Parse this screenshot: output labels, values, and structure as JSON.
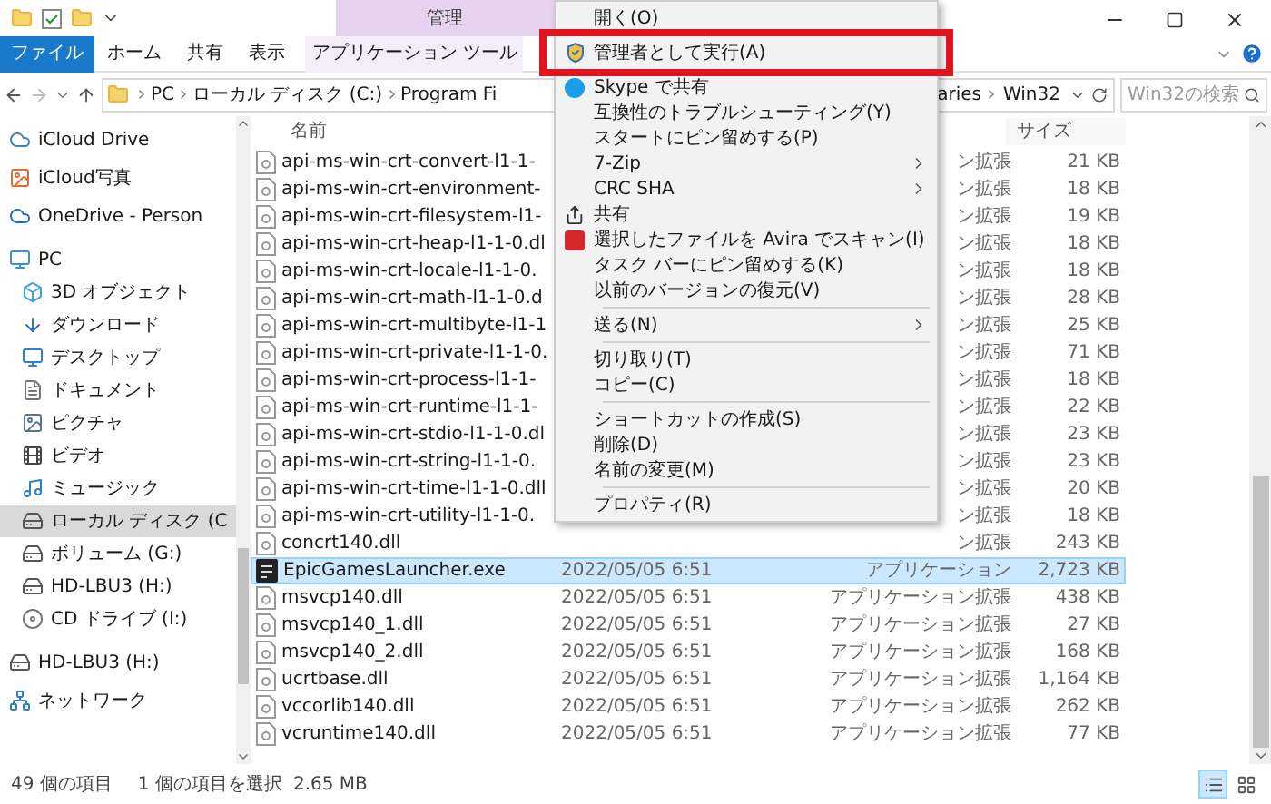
{
  "ribbon": {
    "context_group": "管理",
    "tabs": [
      {
        "label": "ファイル",
        "kind": "file"
      },
      {
        "label": "ホーム",
        "kind": "tab"
      },
      {
        "label": "共有",
        "kind": "tab"
      },
      {
        "label": "表示",
        "kind": "tab"
      },
      {
        "label": "アプリケーション ツール",
        "kind": "contextual"
      }
    ]
  },
  "address": {
    "segments_left": [
      "PC",
      "ローカル ディスク (C:)",
      "Program Fi"
    ],
    "segments_right": [
      "aries",
      "Win32"
    ]
  },
  "search": {
    "placeholder": "Win32の検索"
  },
  "sidebar": {
    "items": [
      {
        "label": "iCloud Drive",
        "kind": "cloud"
      },
      {
        "label": "iCloud写真",
        "kind": "photos"
      },
      {
        "label": "OneDrive - Person",
        "kind": "onedrive"
      },
      {
        "label": "PC",
        "kind": "pc",
        "selected": false,
        "children": [
          {
            "label": "3D オブジェクト",
            "kind": "cube",
            "selected": false
          },
          {
            "label": "ダウンロード",
            "kind": "download",
            "selected": false
          },
          {
            "label": "デスクトップ",
            "kind": "desktop",
            "selected": false
          },
          {
            "label": "ドキュメント",
            "kind": "document",
            "selected": false
          },
          {
            "label": "ピクチャ",
            "kind": "picture",
            "selected": false
          },
          {
            "label": "ビデオ",
            "kind": "video",
            "selected": false
          },
          {
            "label": "ミュージック",
            "kind": "music",
            "selected": false
          },
          {
            "label": "ローカル ディスク (C",
            "kind": "disk",
            "selected": true
          },
          {
            "label": "ボリューム (G:)",
            "kind": "drive",
            "selected": false
          },
          {
            "label": "HD-LBU3 (H:)",
            "kind": "drive",
            "selected": false
          },
          {
            "label": "CD ドライブ (I:)",
            "kind": "cd",
            "selected": false
          }
        ]
      },
      {
        "label": "HD-LBU3 (H:)",
        "kind": "drive"
      },
      {
        "label": "ネットワーク",
        "kind": "network"
      }
    ]
  },
  "table": {
    "columns": [
      "名前",
      "サイズ"
    ],
    "rows": [
      {
        "name": "api-ms-win-crt-convert-l1-1-",
        "type": "ン拡張",
        "size": "21 KB",
        "kind": "dll",
        "selected": false
      },
      {
        "name": "api-ms-win-crt-environment-",
        "type": "ン拡張",
        "size": "18 KB",
        "kind": "dll",
        "selected": false
      },
      {
        "name": "api-ms-win-crt-filesystem-l1-",
        "type": "ン拡張",
        "size": "19 KB",
        "kind": "dll",
        "selected": false
      },
      {
        "name": "api-ms-win-crt-heap-l1-1-0.dl",
        "type": "ン拡張",
        "size": "18 KB",
        "kind": "dll",
        "selected": false
      },
      {
        "name": "api-ms-win-crt-locale-l1-1-0.",
        "type": "ン拡張",
        "size": "18 KB",
        "kind": "dll",
        "selected": false
      },
      {
        "name": "api-ms-win-crt-math-l1-1-0.d",
        "type": "ン拡張",
        "size": "28 KB",
        "kind": "dll",
        "selected": false
      },
      {
        "name": "api-ms-win-crt-multibyte-l1-1",
        "type": "ン拡張",
        "size": "25 KB",
        "kind": "dll",
        "selected": false
      },
      {
        "name": "api-ms-win-crt-private-l1-1-0.",
        "type": "ン拡張",
        "size": "71 KB",
        "kind": "dll",
        "selected": false
      },
      {
        "name": "api-ms-win-crt-process-l1-1-",
        "type": "ン拡張",
        "size": "18 KB",
        "kind": "dll",
        "selected": false
      },
      {
        "name": "api-ms-win-crt-runtime-l1-1-",
        "type": "ン拡張",
        "size": "22 KB",
        "kind": "dll",
        "selected": false
      },
      {
        "name": "api-ms-win-crt-stdio-l1-1-0.dl",
        "type": "ン拡張",
        "size": "23 KB",
        "kind": "dll",
        "selected": false
      },
      {
        "name": "api-ms-win-crt-string-l1-1-0.",
        "type": "ン拡張",
        "size": "23 KB",
        "kind": "dll",
        "selected": false
      },
      {
        "name": "api-ms-win-crt-time-l1-1-0.dll",
        "type": "ン拡張",
        "size": "20 KB",
        "kind": "dll",
        "selected": false
      },
      {
        "name": "api-ms-win-crt-utility-l1-1-0.",
        "type": "ン拡張",
        "size": "18 KB",
        "kind": "dll",
        "selected": false
      },
      {
        "name": "concrt140.dll",
        "type": "ン拡張",
        "size": "243 KB",
        "kind": "dll",
        "selected": false
      },
      {
        "name": "EpicGamesLauncher.exe",
        "date": "2022/05/05 6:51",
        "type": "アプリケーション",
        "size": "2,723 KB",
        "kind": "app",
        "selected": true
      },
      {
        "name": "msvcp140.dll",
        "date": "2022/05/05 6:51",
        "type": "アプリケーション拡張",
        "size": "438 KB",
        "kind": "dll",
        "selected": false
      },
      {
        "name": "msvcp140_1.dll",
        "date": "2022/05/05 6:51",
        "type": "アプリケーション拡張",
        "size": "27 KB",
        "kind": "dll",
        "selected": false
      },
      {
        "name": "msvcp140_2.dll",
        "date": "2022/05/05 6:51",
        "type": "アプリケーション拡張",
        "size": "168 KB",
        "kind": "dll",
        "selected": false
      },
      {
        "name": "ucrtbase.dll",
        "date": "2022/05/05 6:51",
        "type": "アプリケーション拡張",
        "size": "1,164 KB",
        "kind": "dll",
        "selected": false
      },
      {
        "name": "vccorlib140.dll",
        "date": "2022/05/05 6:51",
        "type": "アプリケーション拡張",
        "size": "262 KB",
        "kind": "dll",
        "selected": false
      },
      {
        "name": "vcruntime140.dll",
        "date": "2022/05/05 6:51",
        "type": "アプリケーション拡張",
        "size": "77 KB",
        "kind": "dll",
        "selected": false
      }
    ]
  },
  "context_menu": {
    "items": [
      {
        "kind": "plain",
        "label": "開く(O)",
        "highlighted": false
      },
      {
        "kind": "shield",
        "label": "管理者として実行(A)",
        "highlighted": true
      },
      {
        "kind": "skype",
        "label": "Skype で共有",
        "highlighted": false
      },
      {
        "kind": "plain",
        "label": "互換性のトラブルシューティング(Y)",
        "highlighted": false
      },
      {
        "kind": "plain",
        "label": "スタートにピン留めする(P)",
        "highlighted": false
      },
      {
        "kind": "plain",
        "label": "7-Zip",
        "submenu": true,
        "highlighted": false
      },
      {
        "kind": "plain",
        "label": "CRC SHA",
        "submenu": true,
        "highlighted": false
      },
      {
        "kind": "share",
        "label": "共有",
        "highlighted": false
      },
      {
        "kind": "avira",
        "label": "選択したファイルを Avira でスキャン(I)",
        "highlighted": false
      },
      {
        "kind": "plain",
        "label": "タスク バーにピン留めする(K)",
        "highlighted": false
      },
      {
        "kind": "plain",
        "label": "以前のバージョンの復元(V)",
        "highlighted": false
      },
      {
        "kind": "separator"
      },
      {
        "kind": "plain",
        "label": "送る(N)",
        "submenu": true,
        "highlighted": false
      },
      {
        "kind": "separator"
      },
      {
        "kind": "plain",
        "label": "切り取り(T)",
        "highlighted": false
      },
      {
        "kind": "plain",
        "label": "コピー(C)",
        "highlighted": false
      },
      {
        "kind": "separator"
      },
      {
        "kind": "plain",
        "label": "ショートカットの作成(S)",
        "highlighted": false
      },
      {
        "kind": "plain",
        "label": "削除(D)",
        "highlighted": false
      },
      {
        "kind": "plain",
        "label": "名前の変更(M)",
        "highlighted": false
      },
      {
        "kind": "separator"
      },
      {
        "kind": "plain",
        "label": "プロパティ(R)",
        "highlighted": false
      }
    ]
  },
  "status_bar": {
    "count": "49 個の項目",
    "selection": "1 個の項目を選択",
    "size": "2.65 MB"
  },
  "view_buttons": [
    {
      "kind": "details",
      "selected": true
    },
    {
      "kind": "tiles",
      "selected": false
    }
  ]
}
